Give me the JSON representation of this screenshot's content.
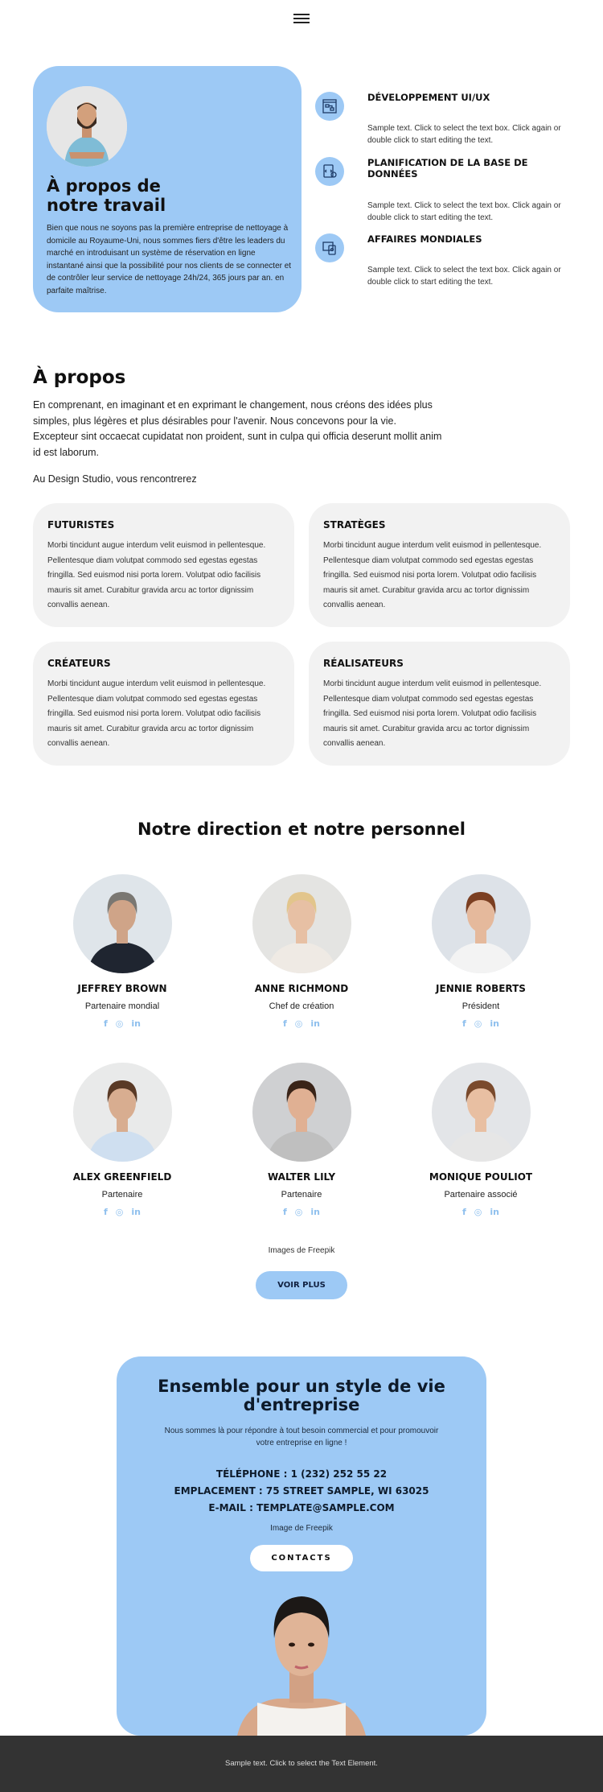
{
  "nav": {
    "menu_icon": "hamburger-icon"
  },
  "hero": {
    "title_line1": "À propos de",
    "title_line2": "notre travail",
    "text": "Bien que nous ne soyons pas la première entreprise de nettoyage à domicile au Royaume-Uni, nous sommes fiers d'être les leaders du marché en introduisant un système de réservation en ligne instantané ainsi que la possibilité pour nos clients de se connecter et de contrôler leur service de nettoyage 24h/24, 365 jours par an. en parfaite maîtrise."
  },
  "features": [
    {
      "title": "DÉVELOPPEMENT UI/UX",
      "text": "Sample text. Click to select the text box. Click again or double click to start editing the text.",
      "icon": "ui-flow-icon"
    },
    {
      "title": "PLANIFICATION DE LA BASE DE DONNÉES",
      "text": "Sample text. Click to select the text box. Click again or double click to start editing the text.",
      "icon": "code-device-icon"
    },
    {
      "title": "AFFAIRES MONDIALES",
      "text": "Sample text. Click to select the text box. Click again or double click to start editing the text.",
      "icon": "business-devices-icon"
    }
  ],
  "about": {
    "title": "À propos",
    "text": "En comprenant, en imaginant et en exprimant le changement, nous créons des idées plus simples, plus légères et plus désirables pour l'avenir. Nous concevons pour la vie. Excepteur sint occaecat cupidatat non proident, sunt in culpa qui officia deserunt mollit anim id est laborum.",
    "intro": "Au Design Studio, vous rencontrerez",
    "cards": [
      {
        "title": "FUTURISTES",
        "text": "Morbi tincidunt augue interdum velit euismod in pellentesque. Pellentesque diam volutpat commodo sed egestas egestas fringilla. Sed euismod nisi porta lorem. Volutpat odio facilisis mauris sit amet. Curabitur gravida arcu ac tortor dignissim convallis aenean."
      },
      {
        "title": "STRATÈGES",
        "text": "Morbi tincidunt augue interdum velit euismod in pellentesque. Pellentesque diam volutpat commodo sed egestas egestas fringilla. Sed euismod nisi porta lorem. Volutpat odio facilisis mauris sit amet. Curabitur gravida arcu ac tortor dignissim convallis aenean."
      },
      {
        "title": "CRÉATEURS",
        "text": "Morbi tincidunt augue interdum velit euismod in pellentesque. Pellentesque diam volutpat commodo sed egestas egestas fringilla. Sed euismod nisi porta lorem. Volutpat odio facilisis mauris sit amet. Curabitur gravida arcu ac tortor dignissim convallis aenean."
      },
      {
        "title": "RÉALISATEURS",
        "text": "Morbi tincidunt augue interdum velit euismod in pellentesque. Pellentesque diam volutpat commodo sed egestas egestas fringilla. Sed euismod nisi porta lorem. Volutpat odio facilisis mauris sit amet. Curabitur gravida arcu ac tortor dignissim convallis aenean."
      }
    ]
  },
  "team": {
    "title": "Notre direction et notre personnel",
    "social": {
      "facebook": "f",
      "instagram": "◎",
      "linkedin": "in"
    },
    "members": [
      {
        "name": "JEFFREY BROWN",
        "role": "Partenaire mondial"
      },
      {
        "name": "ANNE RICHMOND",
        "role": "Chef de création"
      },
      {
        "name": "JENNIE ROBERTS",
        "role": "Président"
      },
      {
        "name": "ALEX GREENFIELD",
        "role": "Partenaire"
      },
      {
        "name": "WALTER LILY",
        "role": "Partenaire"
      },
      {
        "name": "MONIQUE POULIOT",
        "role": "Partenaire associé"
      }
    ],
    "credit": "Images de Freepik",
    "more_button": "VOIR PLUS"
  },
  "contact": {
    "title": "Ensemble pour un style de vie d'entreprise",
    "text": "Nous sommes là pour répondre à tout besoin commercial et pour promouvoir votre entreprise en ligne !",
    "phone": "TÉLÉPHONE : 1 (232) 252 55 22",
    "location": "EMPLACEMENT : 75 STREET SAMPLE, WI 63025",
    "email": "E-MAIL : TEMPLATE@SAMPLE.COM",
    "credit": "Image de Freepik",
    "button": "CONTACTS"
  },
  "footer": {
    "text": "Sample text. Click to select the Text Element."
  },
  "colors": {
    "accent": "#9dc9f5",
    "card": "#f2f2f2",
    "footer": "#333333",
    "social": "#8fc0ee"
  }
}
